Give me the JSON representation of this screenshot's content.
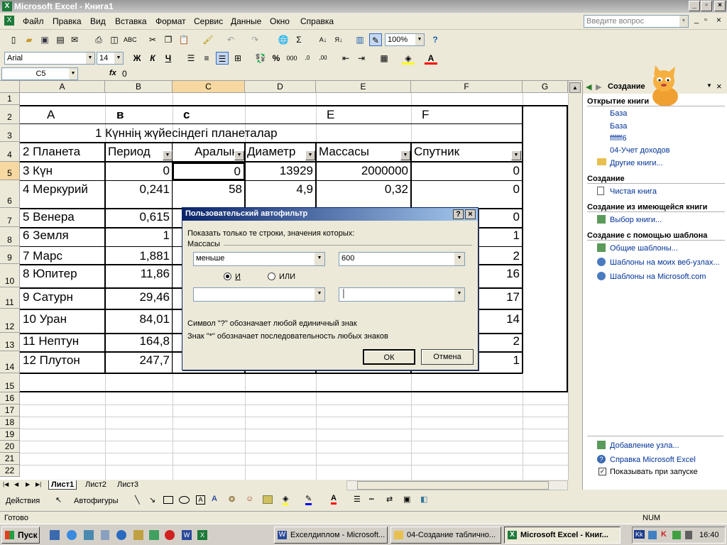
{
  "window": {
    "title": "Microsoft Excel - Книга1"
  },
  "menu": [
    "Файл",
    "Правка",
    "Вид",
    "Вставка",
    "Формат",
    "Сервис",
    "Данные",
    "Окно",
    "Справка"
  ],
  "help_box": {
    "placeholder": "Введите вопрос"
  },
  "toolbar": {
    "zoom": "100%",
    "font": "Arial",
    "size": "14"
  },
  "format_letters": {
    "bold": "Ж",
    "italic": "К",
    "underline": "Ч",
    "percent": "%",
    "thousands": "000"
  },
  "formula_bar": {
    "cell_ref": "C5",
    "fx": "fx",
    "value": "0"
  },
  "columns": [
    "A",
    "B",
    "C",
    "D",
    "E",
    "F",
    "G"
  ],
  "rows": [
    "1",
    "2",
    "3",
    "4",
    "5",
    "6",
    "7",
    "8",
    "9",
    "10",
    "11",
    "12",
    "13",
    "14",
    "15",
    "16",
    "17",
    "18",
    "19",
    "20",
    "21",
    "22"
  ],
  "sheet": {
    "row2": {
      "a": "A",
      "b": "в",
      "c": "с",
      "e": "E",
      "f": "F"
    },
    "title": "1  Күннің жүйесіндегі планеталар",
    "headers": {
      "a": "2 Планета",
      "b": "Период",
      "c": "Аралық",
      "d": "Диаметр",
      "e": "Массасы",
      "f": "Спутник"
    },
    "data": [
      {
        "a": "3 Күн",
        "b": "0",
        "c": "0",
        "d": "13929",
        "e": "2000000",
        "f": "0"
      },
      {
        "a": "4  Меркурий",
        "b": "0,241",
        "c": "58",
        "d": "4,9",
        "e": "0,32",
        "f": "0"
      },
      {
        "a": "5 Венера",
        "b": "0,615",
        "f": "0"
      },
      {
        "a": "6  Земля",
        "b": "1",
        "f": "1"
      },
      {
        "a": "7   Марс",
        "b": "1,881",
        "f": "2"
      },
      {
        "a": "8   Юпитер",
        "b": "11,86",
        "f": "16"
      },
      {
        "a": "9  Сатурн",
        "b": "29,46",
        "f": "17"
      },
      {
        "a": "10 Уран",
        "b": "84,01",
        "f": "14"
      },
      {
        "a": "11 Нептун",
        "b": "164,8",
        "f": "2"
      },
      {
        "a": "12 Плутон",
        "b": "247,7",
        "f": "1"
      }
    ]
  },
  "dialog": {
    "title": "Пользовательский автофильтр",
    "help": "?",
    "close": "×",
    "instruction": "Показать только те строки, значения которых:",
    "field": "Массасы",
    "op1": "меньше",
    "val1": "600",
    "and_label": "И",
    "or_label": "ИЛИ",
    "op2": "",
    "val2": "",
    "hint1": "Символ \"?\" обозначает любой единичный знак",
    "hint2": "Знак \"*\" обозначает последовательность любых знаков",
    "ok": "ОК",
    "cancel": "Отмена"
  },
  "taskpane": {
    "title": "Создание",
    "open_head": "Открытие книги",
    "open_items": [
      "База",
      "База",
      "ffffff6",
      "04-Учет доходов"
    ],
    "more": "Другие книги...",
    "create_head": "Создание",
    "blank": "Чистая книга",
    "existing_head": "Создание из имеющейся книги",
    "choose": "Выбор книги...",
    "template_head": "Создание с помощью шаблона",
    "templates": [
      "Общие шаблоны...",
      "Шаблоны на моих веб-узлах...",
      "Шаблоны на Microsoft.com"
    ],
    "add_node": "Добавление узла...",
    "help": "Справка Microsoft Excel",
    "show_startup": "Показывать при запуске"
  },
  "sheet_tabs": [
    "Лист1",
    "Лист2",
    "Лист3"
  ],
  "draw": {
    "actions": "Действия",
    "autoshapes": "Автофигуры"
  },
  "status": {
    "left": "Готово",
    "num": "NUM"
  },
  "taskbar": {
    "start": "Пуск",
    "tasks": [
      "Exceлдиплом - Microsoft...",
      "04-Создание таблично...",
      "Microsoft Excel - Книг..."
    ],
    "lang": "Kk",
    "clock": "16:40"
  }
}
